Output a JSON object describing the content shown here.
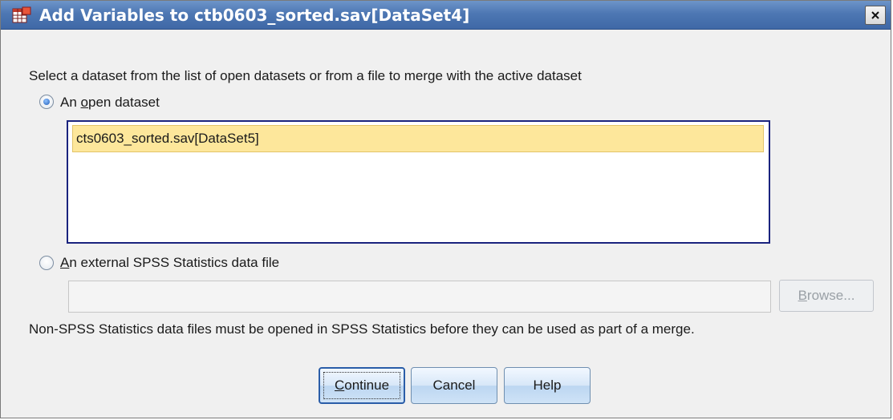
{
  "window": {
    "title": "Add Variables to ctb0603_sorted.sav[DataSet4]",
    "app_icon": "spss-dataset-icon",
    "close_icon": "close-icon"
  },
  "instruction": "Select a dataset from the list of open datasets or from a file to merge with the active dataset",
  "open_dataset": {
    "label_pre": "An ",
    "label_mnemonic": "o",
    "label_post": "pen dataset",
    "selected": true,
    "items": [
      {
        "label": "cts0603_sorted.sav[DataSet5]",
        "selected": true
      }
    ]
  },
  "external_file": {
    "label_mnemonic": "A",
    "label_post": "n external SPSS Statistics data file",
    "selected": false,
    "value": "",
    "browse_mnemonic": "B",
    "browse_post": "rowse..."
  },
  "note": "Non-SPSS Statistics data files must be opened in SPSS Statistics before they can be used as part of a merge.",
  "buttons": {
    "continue_mnemonic": "C",
    "continue_post": "ontinue",
    "cancel": "Cancel",
    "help": "Help"
  },
  "colors": {
    "titlebar": "#4d77b3",
    "selection": "#fde79b",
    "list_border": "#1a237e"
  }
}
